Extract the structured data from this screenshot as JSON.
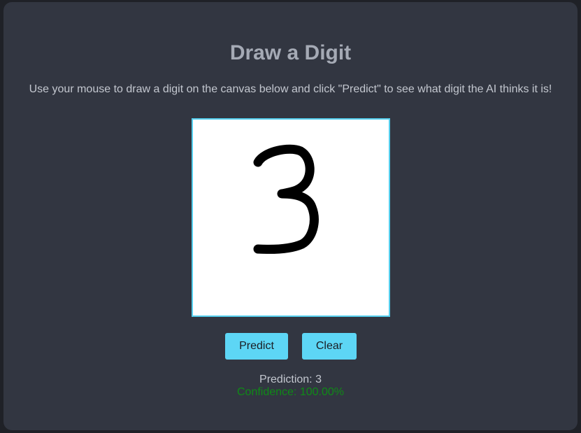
{
  "page": {
    "title": "Draw a Digit",
    "instructions": "Use your mouse to draw a digit on the canvas below and click \"Predict\" to see what digit the AI thinks it is!"
  },
  "canvas": {
    "drawn_digit": "3",
    "stroke_color": "#000000",
    "background_color": "#ffffff",
    "border_color": "#55cfee"
  },
  "buttons": {
    "predict_label": "Predict",
    "clear_label": "Clear",
    "color": "#5dd6f5"
  },
  "result": {
    "prediction_label": "Prediction:",
    "prediction_value": "3",
    "confidence_label": "Confidence:",
    "confidence_value": "100.00%",
    "confidence_color": "#0f8a17"
  }
}
